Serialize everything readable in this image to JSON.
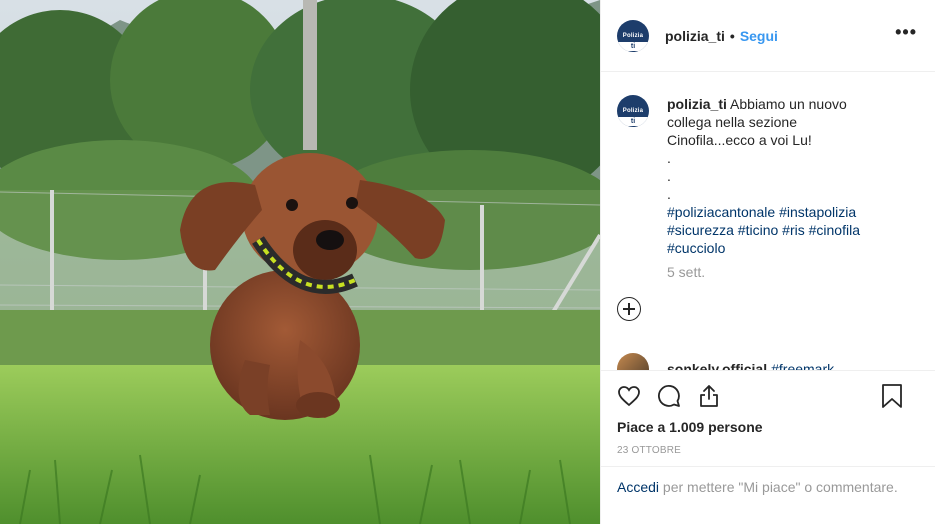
{
  "account": {
    "username": "polizia_ti",
    "separator": "•",
    "follow_label": "Segui",
    "more_label": "•••",
    "avatar_text": "Polizia",
    "avatar_sub": "ti"
  },
  "caption": {
    "username": "polizia_ti",
    "lines": [
      "Abbiamo un nuovo",
      "collega nella sezione",
      "Cinofila...ecco a voi Lu!",
      ".",
      ".",
      "."
    ],
    "hashtag_lines": [
      "#poliziacantonale #instapolizia",
      "#sicurezza #ticino #ris #cinofila",
      "#cucciolo"
    ],
    "time": "5 sett."
  },
  "comment2": {
    "username": "sonkely.official",
    "text": "#freemark"
  },
  "likes_text": "Piace a 1.009 persone",
  "date": "23 OTTOBRE",
  "login": {
    "link": "Accedi",
    "text": " per mettere \"Mi piace\" o commentare."
  },
  "icons": [
    "heart-icon",
    "comment-icon",
    "share-icon",
    "bookmark-icon",
    "add-comment-icon"
  ],
  "colors": {
    "link": "#3897f0",
    "hashtag": "#003569",
    "muted": "#999999"
  }
}
